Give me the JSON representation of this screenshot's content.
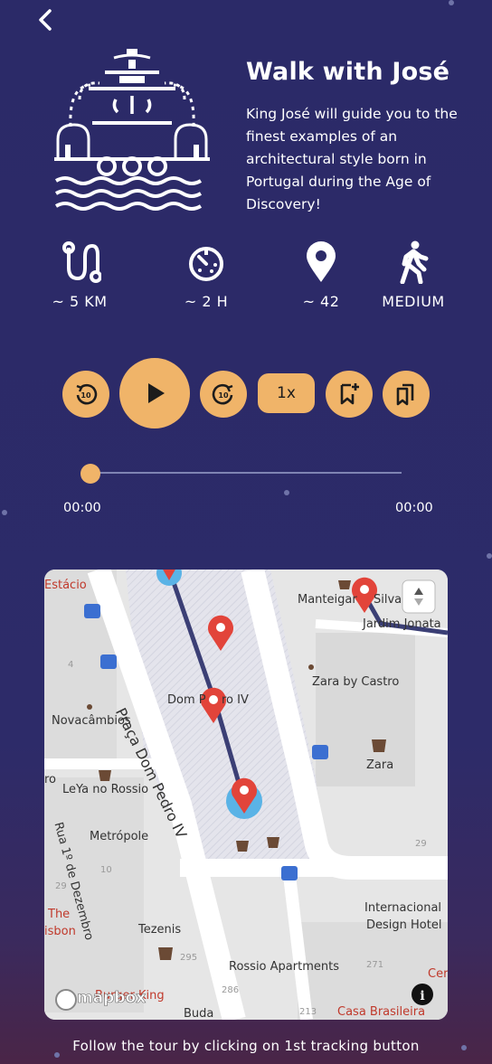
{
  "header": {
    "title": "Walk with José",
    "description": "King José will guide you to the finest examples of an architectural style born in Portugal during the Age of Discovery!"
  },
  "stats": [
    {
      "icon": "route-icon",
      "value": "~ 5 KM"
    },
    {
      "icon": "timer-icon",
      "value": "~ 2 H"
    },
    {
      "icon": "location-pin-icon",
      "value": "~ 42"
    },
    {
      "icon": "walking-person-icon",
      "value": "MEDIUM"
    }
  ],
  "player": {
    "speed_label": "1x",
    "elapsed": "00:00",
    "duration": "00:00",
    "progress": 0
  },
  "map": {
    "labels": {
      "estacio": "Estácio",
      "manteigaria": "Manteigar",
      "silva": "Silva",
      "jardim": "Jardim Jonata",
      "dom_pedro": "Dom P",
      "dom_pedro_iv": "ro IV",
      "zara_castro": "Zara by Castro",
      "novacambios": "Novacâmbios",
      "praca": "Praça Dom Pedro IV",
      "zara": "Zara",
      "leya": "LeYa no Rossio",
      "ro": "ro",
      "metropole": "Metrópole",
      "rua": "Rua 1º de Dezembro",
      "the": "The",
      "lisbon": "isbon",
      "tezenis": "Tezenis",
      "internacional": "Internacional",
      "design_hotel": "Design Hotel",
      "rossio_apts": "Rossio Apartments",
      "burger": "Burger King",
      "buda": "Buda",
      "casa": "Casa Brasileira",
      "cer": "Cer",
      "n4": "4",
      "n10": "10",
      "n29": "29",
      "n295": "295",
      "n271": "271",
      "n29b": "29",
      "n286": "286",
      "n213": "213"
    },
    "brand": "mapbox"
  },
  "footer": {
    "hint": "Follow the tour by clicking on 1st tracking button"
  },
  "colors": {
    "background": "#2b2a68",
    "accent": "#f0b469",
    "marker": "#e2443a",
    "route": "#3b3f75"
  }
}
